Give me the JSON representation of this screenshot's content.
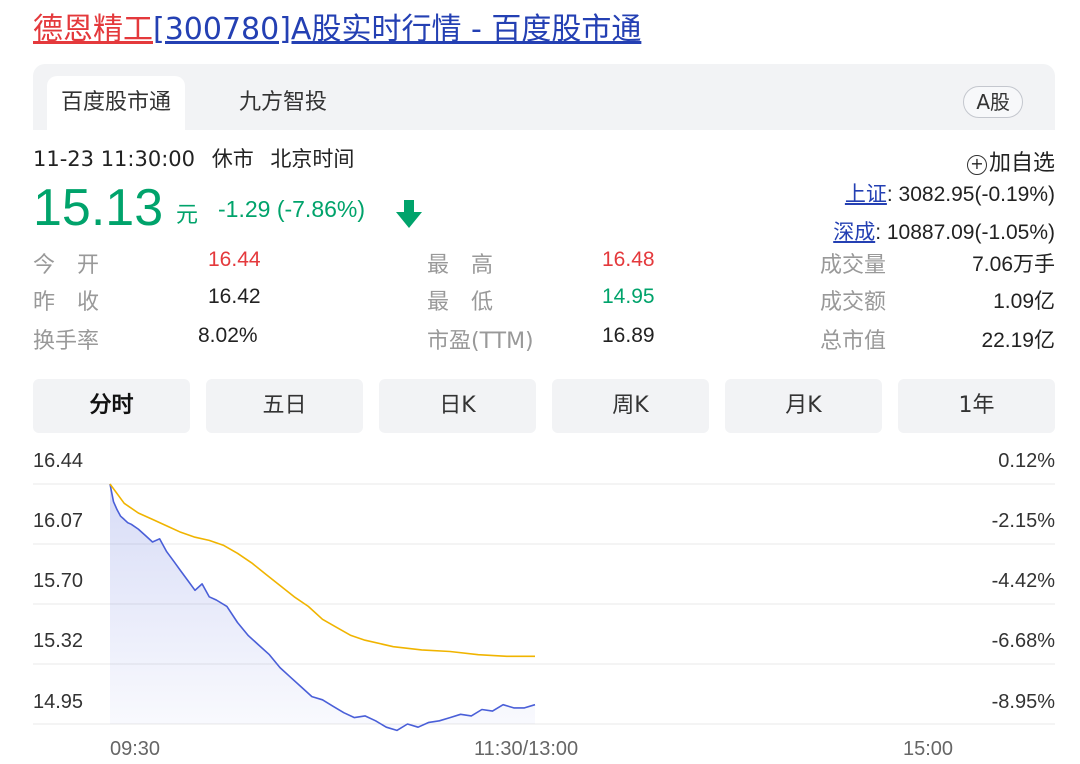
{
  "page_title": {
    "name": "德恩精工",
    "code_and_suffix": "[300780]A股实时行情 - 百度股市通"
  },
  "tabs": {
    "items": [
      "百度股市通",
      "九方智投"
    ],
    "badge": "A股"
  },
  "status": {
    "datetime": "11-23 11:30:00",
    "market_state": "休市",
    "timezone": "北京时间"
  },
  "quote": {
    "price": "15.13",
    "unit": "元",
    "change": "-1.29 (-7.86%)",
    "direction_icon": "down-arrow-icon"
  },
  "actions": {
    "add_watchlist": "加自选"
  },
  "indices": {
    "shanghai_label": "上证",
    "shanghai_value": ": 3082.95(-0.19%)",
    "shenzhen_label": "深成",
    "shenzhen_value": ": 10887.09(-1.05%)"
  },
  "stats": {
    "open_label": "今　开",
    "open_value": "16.44",
    "high_label": "最　高",
    "high_value": "16.48",
    "volume_label": "成交量",
    "volume_value": "7.06万手",
    "prev_close_label": "昨　收",
    "prev_close_value": "16.42",
    "low_label": "最　低",
    "low_value": "14.95",
    "amount_label": "成交额",
    "amount_value": "1.09亿",
    "turnover_label": "换手率",
    "turnover_value": "8.02%",
    "pe_label": "市盈(TTM)",
    "pe_value": "16.89",
    "market_cap_label": "总市值",
    "market_cap_value": "22.19亿"
  },
  "range_tabs": [
    "分时",
    "五日",
    "日K",
    "周K",
    "月K",
    "1年"
  ],
  "colors": {
    "down_green": "#00a36b",
    "up_red": "#e4393c",
    "price_line": "#4a5fd8",
    "avg_line": "#f0b400",
    "link_blue": "#2440b3"
  },
  "chart_data": {
    "type": "line",
    "y_ticks_left": [
      "16.44",
      "16.07",
      "15.70",
      "15.32",
      "14.95"
    ],
    "y_ticks_right": [
      "0.12%",
      "-2.15%",
      "-4.42%",
      "-6.68%",
      "-8.95%"
    ],
    "x_ticks": [
      "09:30",
      "11:30/13:00",
      "15:00"
    ],
    "ylim": [
      14.95,
      16.44
    ],
    "x_total_minutes": 240,
    "series": [
      {
        "key": "price",
        "color": "#4a5fd8",
        "x": [
          0,
          1,
          2,
          3,
          4,
          5,
          6,
          8,
          10,
          12,
          14,
          16,
          18,
          20,
          22,
          24,
          26,
          28,
          30,
          33,
          36,
          39,
          42,
          45,
          48,
          51,
          54,
          57,
          60,
          63,
          66,
          69,
          72,
          75,
          78,
          81,
          84,
          87,
          90,
          93,
          96,
          99,
          102,
          105,
          108,
          111,
          114,
          117,
          120
        ],
        "y": [
          16.44,
          16.33,
          16.28,
          16.24,
          16.22,
          16.2,
          16.19,
          16.16,
          16.12,
          16.08,
          16.1,
          16.02,
          15.96,
          15.9,
          15.84,
          15.78,
          15.82,
          15.74,
          15.72,
          15.68,
          15.58,
          15.5,
          15.44,
          15.38,
          15.3,
          15.24,
          15.18,
          15.12,
          15.1,
          15.06,
          15.02,
          14.99,
          15.0,
          14.97,
          14.93,
          14.91,
          14.95,
          14.93,
          14.96,
          14.97,
          14.99,
          15.01,
          15.0,
          15.04,
          15.03,
          15.07,
          15.05,
          15.05,
          15.07
        ]
      },
      {
        "key": "average",
        "color": "#f0b400",
        "x": [
          0,
          4,
          8,
          12,
          16,
          20,
          24,
          28,
          32,
          36,
          40,
          44,
          48,
          52,
          56,
          60,
          64,
          68,
          72,
          80,
          88,
          96,
          104,
          112,
          120
        ],
        "y": [
          16.44,
          16.32,
          16.26,
          16.22,
          16.18,
          16.14,
          16.11,
          16.09,
          16.06,
          16.01,
          15.95,
          15.88,
          15.81,
          15.74,
          15.68,
          15.6,
          15.55,
          15.5,
          15.47,
          15.43,
          15.41,
          15.4,
          15.38,
          15.37,
          15.37
        ]
      }
    ]
  }
}
